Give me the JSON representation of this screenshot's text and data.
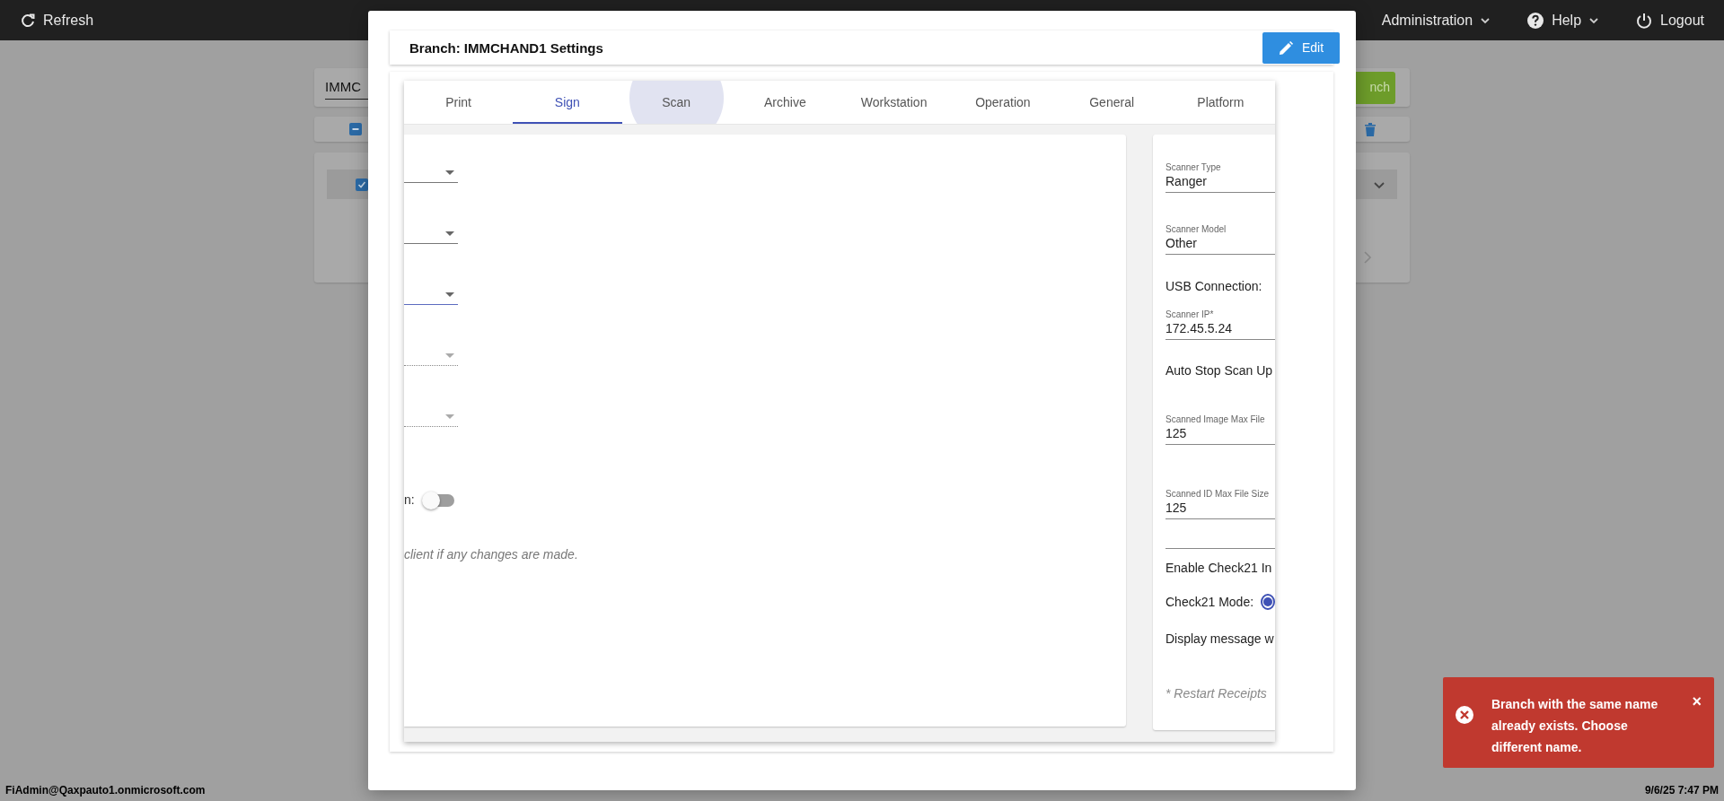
{
  "top_bar": {
    "refresh": "Refresh",
    "menus": [
      {
        "kind": "menu",
        "label": "Administration"
      },
      {
        "kind": "help",
        "label": "Help"
      },
      {
        "kind": "logout",
        "label": "Logout"
      }
    ]
  },
  "background": {
    "search_value": "IMMC",
    "button_label": "nch",
    "header_indeterminate": true,
    "row_checked": true
  },
  "modal": {
    "title": "Branch: IMMCHAND1 Settings",
    "edit_label": "Edit",
    "tabs": [
      {
        "label": "Print",
        "selected": false,
        "hovered": false
      },
      {
        "label": "Sign",
        "selected": true,
        "hovered": false
      },
      {
        "label": "Scan",
        "selected": false,
        "hovered": true
      },
      {
        "label": "Archive",
        "selected": false,
        "hovered": false
      },
      {
        "label": "Workstation",
        "selected": false,
        "hovered": false
      },
      {
        "label": "Operation",
        "selected": false,
        "hovered": false
      },
      {
        "label": "General",
        "selected": false,
        "hovered": false
      },
      {
        "label": "Platform",
        "selected": false,
        "hovered": false
      }
    ],
    "left_selects": [
      {
        "disabled": false,
        "focused": false
      },
      {
        "disabled": false,
        "focused": false
      },
      {
        "disabled": false,
        "focused": true
      },
      {
        "disabled": true,
        "focused": false
      },
      {
        "disabled": true,
        "focused": false
      }
    ],
    "toggle": {
      "label": "n:",
      "on": false
    },
    "note": "client if any changes are made.",
    "right_items": [
      {
        "kind": "field",
        "label": "Scanner Type",
        "value": "Ranger"
      },
      {
        "kind": "field",
        "label": "Scanner Model",
        "value": "Other"
      },
      {
        "kind": "text",
        "label": "USB Connection:"
      },
      {
        "kind": "field",
        "label": "Scanner IP*",
        "value": "172.45.5.24"
      },
      {
        "kind": "text",
        "label": "Auto Stop Scan Up"
      },
      {
        "kind": "field",
        "label": "Scanned Image Max File",
        "value": "125"
      },
      {
        "kind": "field",
        "label": "Scanned ID Max File Size",
        "value": "125"
      },
      {
        "kind": "blank"
      },
      {
        "kind": "text",
        "label": "Enable Check21 In"
      },
      {
        "kind": "radio",
        "label": "Check21 Mode:",
        "selected": true
      },
      {
        "kind": "text",
        "label": "Display message w"
      },
      {
        "kind": "note",
        "label": "* Restart Receipts"
      }
    ]
  },
  "toast": {
    "message": "Branch with the same name already exists. Choose different name.",
    "close": "×"
  },
  "status_bar": {
    "user": "FiAdmin@Qaxpauto1.onmicrosoft.com",
    "datetime": "9/6/25 7:47 PM"
  }
}
